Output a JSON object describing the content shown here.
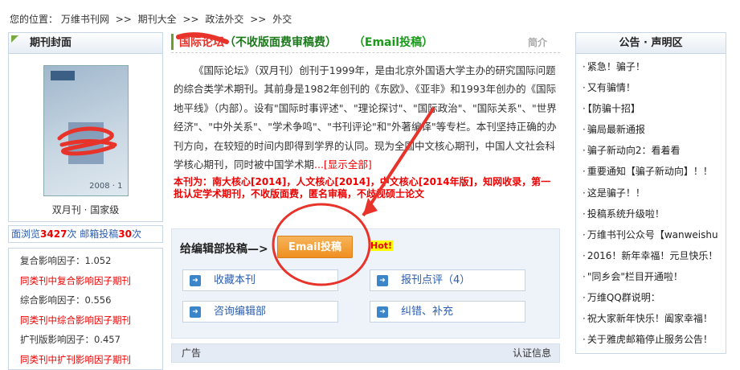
{
  "breadcrumb": {
    "prefix": "您的位置：",
    "items": [
      "万维书刊网",
      "期刊大全",
      "政法外交",
      "外交"
    ],
    "sep": ">>"
  },
  "left": {
    "cover_header": "期刊封面",
    "cover_year": "2008 · 1",
    "frequency": "双月刊 · 国家级",
    "stats": {
      "views_label": "面浏览",
      "views": "3427",
      "views_unit": "次",
      "email_label": "邮箱投稿",
      "email": "30",
      "email_unit": "次"
    },
    "factors": [
      {
        "text": "复合影响因子：1.052",
        "style": "k"
      },
      {
        "text": "同类刊中复合影响因子期刊",
        "style": "r"
      },
      {
        "text": "综合影响因子：0.556",
        "style": "k"
      },
      {
        "text": "同类刊中综合影响因子期刊",
        "style": "r"
      },
      {
        "text": "扩刊版影响因子：0.457",
        "style": "k"
      },
      {
        "text": "同类刊中扩刊影响因子期刊",
        "style": "r"
      }
    ]
  },
  "main": {
    "title_prefix": "国际论坛",
    "title_main": "（不收版面费审稿费）",
    "title_email": "（Email投稿）",
    "section_label": "简介",
    "description": "《国际论坛》（双月刊）创刊于1999年，是由北京外国语大学主办的研究国际问题的综合类学术期刊。其前身是1982年创刊的《东欧》、《亚非》和1993年创办的《国际地平线》（内部）。设有\"国际时事评述\"、\"理论探讨\"、\"国际政治\"、\"国际关系\"、\"世界经济\"、\"中外关系\"、\"学术争鸣\"、\"书刊评论\"和\"外著编译\"等专栏。本刊坚持正确的办刊方向，在较短的时间内即得到学界的认同。现为全国中文核心期刊，中国人文社会科学核心期刊，同时被中国学术期",
    "show_all": "...[显示全部]",
    "red_note": "本刊为：南大核心[2014]，人文核心[2014]，中文核心[2014年版]，知网收录，第一批认定学术期刊，不收版面费，匿名审稿，不歧视硕士论文",
    "submit_label": "给编辑部投稿—>",
    "email_button": "Email投稿",
    "hot": "Hot!",
    "buttons": [
      "收藏本刊",
      "报刊点评（4）",
      "咨询编辑部",
      "纠错、补充"
    ],
    "ad_label": "广告",
    "ad_right": "认证信息"
  },
  "notice": {
    "header": "公告 · 声明区",
    "items": [
      "紧急！骗子！",
      "又有骗情！",
      "【防骗十招】",
      "骗局最新通报",
      "骗子新动向2：看着看",
      "重要通知【骗子新动向】！！",
      "这是骗子！！",
      "投稿系统升级啦！",
      "万维书刊公众号【wanweishu",
      "2016！新年幸福！元旦快乐！",
      "\"同乡会\"栏目开通啦！",
      "万维QQ群说明：",
      "祝大家新年快乐！阖家幸福！",
      "关于雅虎邮箱停止服务公告！"
    ]
  },
  "colors": {
    "accent_green": "#1a7a1a",
    "red": "#e00000",
    "link_blue": "#2a5db0",
    "email_orange": "#ef8f1f",
    "annotation_red": "#e8332a"
  }
}
